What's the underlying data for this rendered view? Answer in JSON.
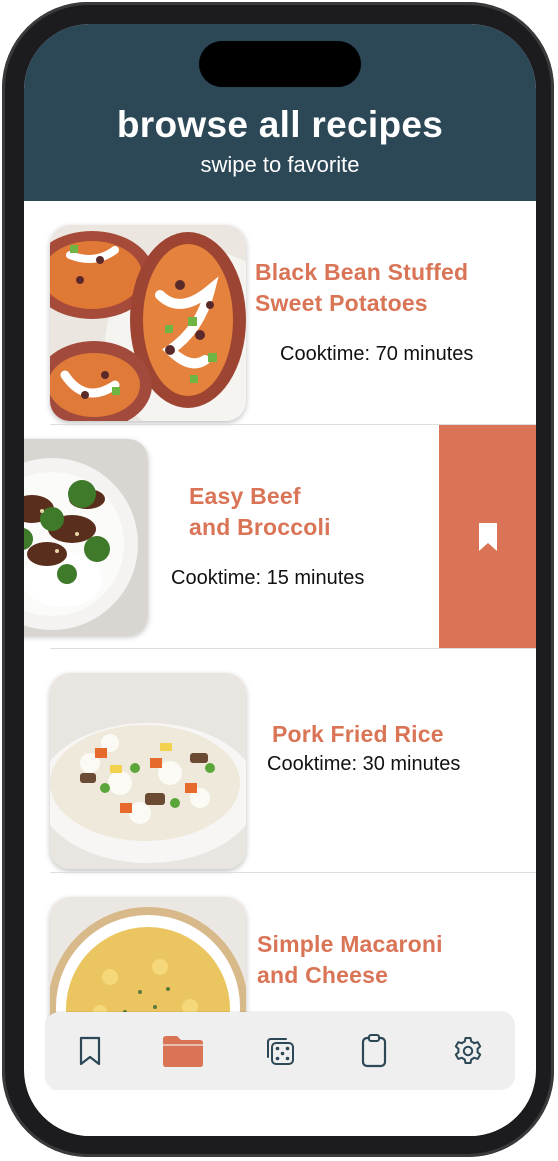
{
  "colors": {
    "header_bg": "#2c4756",
    "accent": "#d97556",
    "tab_icon": "#2c4756"
  },
  "header": {
    "title": "browse all recipes",
    "subtitle": "swipe to favorite"
  },
  "recipes": [
    {
      "title_lines": [
        "Black Bean Stuffed",
        "Sweet Potatoes"
      ],
      "cooktime": "Cooktime: 70 minutes",
      "image_icon": "sweet-potato-photo"
    },
    {
      "title_lines": [
        "Easy Beef",
        "and Broccoli"
      ],
      "cooktime": "Cooktime: 15 minutes",
      "image_icon": "beef-broccoli-photo",
      "swipe_action_icon": "bookmark-icon"
    },
    {
      "title_lines": [
        "Pork Fried Rice"
      ],
      "cooktime": "Cooktime: 30 minutes",
      "image_icon": "fried-rice-photo"
    },
    {
      "title_lines": [
        "Simple Macaroni",
        "and Cheese"
      ],
      "image_icon": "mac-cheese-photo"
    }
  ],
  "tabbar": {
    "active": "browse",
    "items": [
      {
        "name": "favorites",
        "icon": "bookmark-icon"
      },
      {
        "name": "browse",
        "icon": "folder-icon"
      },
      {
        "name": "random",
        "icon": "dice-icon"
      },
      {
        "name": "list",
        "icon": "clipboard-icon"
      },
      {
        "name": "settings",
        "icon": "gear-icon"
      }
    ]
  }
}
